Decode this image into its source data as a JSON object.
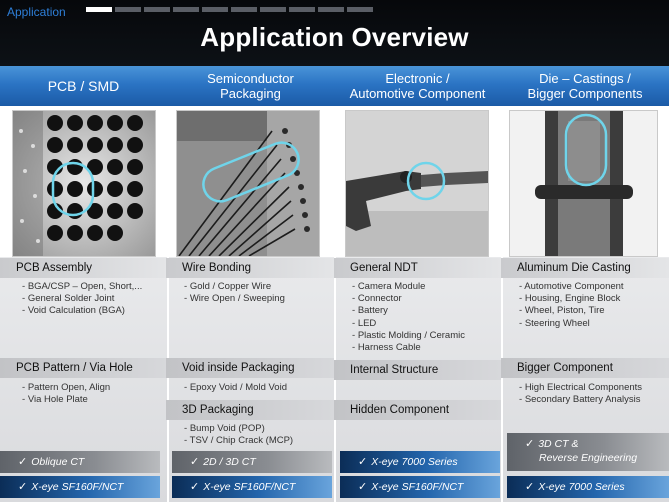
{
  "header": {
    "app_label": "Application",
    "title": "Application Overview",
    "progress_total": 10,
    "progress_active_index": 0
  },
  "colors": {
    "accent_blue": "#2b74c4",
    "app_label": "#2e7fd8",
    "highlight_ring": "#6fd4ea"
  },
  "columns": [
    {
      "title": "PCB / SMD"
    },
    {
      "title_line1": "Semiconductor",
      "title_line2": "Packaging"
    },
    {
      "title_line1": "Electronic /",
      "title_line2": "Automotive Component"
    },
    {
      "title_line1": "Die – Castings /",
      "title_line2": "Bigger Components"
    }
  ],
  "sections": {
    "pcb_assembly": {
      "heading": "PCB Assembly",
      "items": [
        "BGA/CSP – Open, Short,...",
        "General Solder Joint",
        "Void Calculation (BGA)"
      ]
    },
    "pcb_pattern": {
      "heading": "PCB Pattern / Via Hole",
      "items": [
        "Pattern Open, Align",
        "Via Hole Plate"
      ]
    },
    "wire_bonding": {
      "heading": "Wire Bonding",
      "items": [
        "Gold / Copper Wire",
        "Wire Open / Sweeping"
      ]
    },
    "void_packaging": {
      "heading": "Void inside Packaging",
      "items": [
        "Epoxy Void / Mold Void"
      ]
    },
    "packaging_3d": {
      "heading": "3D Packaging",
      "items": [
        "Bump Void (POP)",
        "TSV / Chip Crack (MCP)"
      ]
    },
    "general_ndt": {
      "heading": "General NDT",
      "items": [
        "Camera Module",
        "Connector",
        "Battery",
        "LED",
        "Plastic Molding / Ceramic",
        "Harness Cable"
      ]
    },
    "internal_structure": {
      "heading": "Internal Structure"
    },
    "hidden_component": {
      "heading": "Hidden Component"
    },
    "aluminum_die": {
      "heading": "Aluminum Die Casting",
      "items": [
        "Automotive Component",
        "Housing, Engine Block",
        "Wheel, Piston, Tire",
        "Steering Wheel"
      ]
    },
    "bigger_component": {
      "heading": "Bigger Component",
      "items": [
        "High Electrical Components",
        "Secondary Battery Analysis"
      ]
    }
  },
  "badges": {
    "col1_top": "Oblique CT",
    "col1_bottom": "X-eye SF160F/NCT",
    "col2_top": "2D / 3D CT",
    "col2_bottom": "X-eye SF160F/NCT",
    "col3_top": "X-eye 7000 Series",
    "col3_bottom": "X-eye SF160F/NCT",
    "col4_top_line1": "3D CT &",
    "col4_top_line2": "Reverse Engineering",
    "col4_bottom": "X-eye 7000 Series",
    "check_icon": "checkmark-icon"
  }
}
